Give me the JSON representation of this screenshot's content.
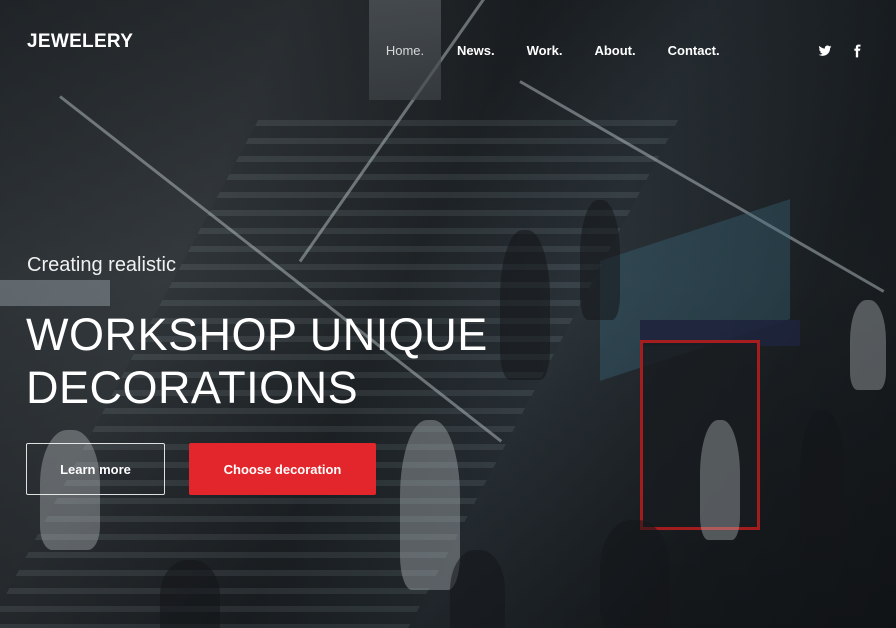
{
  "brand": {
    "logo_text": "JEWELERY"
  },
  "nav": {
    "items": [
      {
        "label": "Home.",
        "active": true
      },
      {
        "label": "News.",
        "active": false
      },
      {
        "label": "Work.",
        "active": false
      },
      {
        "label": "About.",
        "active": false
      },
      {
        "label": "Contact.",
        "active": false
      }
    ]
  },
  "social": {
    "icons": [
      "twitter-icon",
      "facebook-icon"
    ]
  },
  "hero": {
    "kicker": "Creating realistic",
    "headline_line1": "WORKSHOP UNIQUE",
    "headline_line2": "DECORATIONS",
    "secondary_button": "Learn more",
    "primary_button": "Choose decoration"
  },
  "colors": {
    "accent": "#e3262b",
    "nav_active_bg": "#464a4e",
    "text": "#ffffff"
  }
}
